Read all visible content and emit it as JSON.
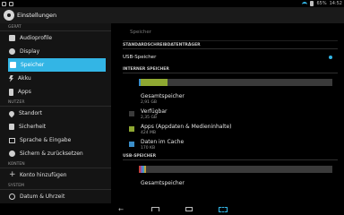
{
  "status": {
    "battery": "65%",
    "time": "14:52"
  },
  "app": {
    "title": "Einstellungen"
  },
  "sidebar": {
    "sections": [
      {
        "label": "GERÄT",
        "items": [
          {
            "label": "Audioprofile",
            "icon": "speaker-icon"
          },
          {
            "label": "Display",
            "icon": "display-icon"
          },
          {
            "label": "Speicher",
            "icon": "storage-icon",
            "active": true
          },
          {
            "label": "Akku",
            "icon": "battery-icon"
          },
          {
            "label": "Apps",
            "icon": "apps-icon"
          }
        ]
      },
      {
        "label": "NUTZER",
        "items": [
          {
            "label": "Standort",
            "icon": "location-icon"
          },
          {
            "label": "Sicherheit",
            "icon": "lock-icon"
          },
          {
            "label": "Sprache & Eingabe",
            "icon": "language-icon"
          },
          {
            "label": "Sichern & zurücksetzen",
            "icon": "backup-icon"
          }
        ]
      },
      {
        "label": "KONTEN",
        "items": [
          {
            "label": "Konto hinzufügen",
            "icon": "plus-icon"
          }
        ]
      },
      {
        "label": "SYSTEM",
        "items": [
          {
            "label": "Datum & Uhrzeit",
            "icon": "clock-icon"
          }
        ]
      }
    ]
  },
  "content": {
    "breadcrumb": "Speicher",
    "default_storage_header": "STANDARDSCHREIBDATENTRÄGER",
    "usb_option": "USB-Speicher",
    "internal_header": "INTERNER SPEICHER",
    "internal_items": [
      {
        "label": "Gesamtspeicher",
        "value": "2,91 GB",
        "color": "#3a3a3a"
      },
      {
        "label": "Verfügbar",
        "value": "2,35 GB",
        "color": "#3a3a3a"
      },
      {
        "label": "Apps (Appdaten & Medieninhalte)",
        "value": "424 MB",
        "color": "#6a8a2a"
      },
      {
        "label": "Daten im Cache",
        "value": "170 KB",
        "color": "#3a8ec9"
      }
    ],
    "usb_header": "USB-SPEICHER",
    "usb_items": [
      {
        "label": "Gesamtspeicher",
        "value": ""
      }
    ]
  },
  "colors": {
    "accent": "#33b5e5"
  }
}
